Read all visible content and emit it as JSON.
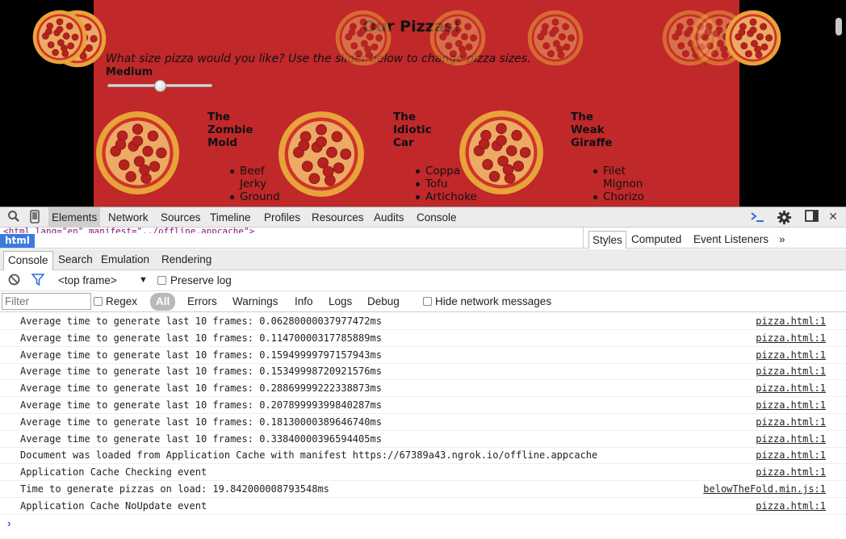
{
  "page": {
    "title": "Our Pizzas!",
    "size_prompt": "What size pizza would you like? Use the slider below to change pizza sizes.",
    "size_label": "Medium",
    "slider_fraction": 0.5,
    "menu": [
      {
        "name": [
          "The",
          "Zombie",
          "Mold"
        ],
        "ingredients": [
          [
            "Beef",
            "Jerky"
          ],
          [
            "Ground"
          ]
        ]
      },
      {
        "name": [
          "The",
          "Idiotic",
          "Car"
        ],
        "ingredients": [
          [
            "Coppa"
          ],
          [
            "Tofu"
          ],
          [
            "Artichoke"
          ]
        ]
      },
      {
        "name": [
          "The",
          "Weak",
          "Giraffe"
        ],
        "ingredients": [
          [
            "Filet",
            "Mignon"
          ],
          [
            "Chorizo"
          ]
        ]
      }
    ]
  },
  "devtools": {
    "tabs": [
      "Elements",
      "Network",
      "Sources",
      "Timeline",
      "Profiles",
      "Resources",
      "Audits",
      "Console"
    ],
    "active_tab": "Elements",
    "html_snippet": "<html lang=\"en\" manifest=\"../offline.appcache\">",
    "breadcrumb": "html",
    "side_tabs": [
      "Styles",
      "Computed",
      "Event Listeners"
    ],
    "side_more": "»",
    "drawer_tabs": [
      "Console",
      "Search",
      "Emulation",
      "Rendering"
    ],
    "frame_select": "<top frame>",
    "preserve_log": "Preserve log",
    "filter_placeholder": "Filter",
    "regex": "Regex",
    "levels": [
      "All",
      "Errors",
      "Warnings",
      "Info",
      "Logs",
      "Debug"
    ],
    "hide_network": "Hide network messages",
    "prompt": "›",
    "messages": [
      {
        "text": "Average time to generate last 10 frames: 0.06280000037977472ms",
        "source": "pizza.html:1"
      },
      {
        "text": "Average time to generate last 10 frames: 0.11470000317785889ms",
        "source": "pizza.html:1"
      },
      {
        "text": "Average time to generate last 10 frames: 0.15949999797157943ms",
        "source": "pizza.html:1"
      },
      {
        "text": "Average time to generate last 10 frames: 0.15349998720921576ms",
        "source": "pizza.html:1"
      },
      {
        "text": "Average time to generate last 10 frames: 0.28869999222338873ms",
        "source": "pizza.html:1"
      },
      {
        "text": "Average time to generate last 10 frames: 0.20789999399840287ms",
        "source": "pizza.html:1"
      },
      {
        "text": "Average time to generate last 10 frames: 0.18130000389646740ms",
        "source": "pizza.html:1"
      },
      {
        "text": "Average time to generate last 10 frames: 0.33840000396594405ms",
        "source": "pizza.html:1"
      },
      {
        "text": "Document was loaded from Application Cache with manifest https://67389a43.ngrok.io/offline.appcache",
        "source": "pizza.html:1"
      },
      {
        "text": "Application Cache Checking event",
        "source": "pizza.html:1"
      },
      {
        "text": "Time to generate pizzas on load: 19.842000008793548ms",
        "source": "belowTheFold.min.js:1"
      },
      {
        "text": "Application Cache NoUpdate event",
        "source": "pizza.html:1"
      }
    ]
  },
  "colors": {
    "page_bg": "#c0282a",
    "viewport_bg": "#000000",
    "link_blue": "#3b7bde",
    "crust": "#e8a33a",
    "sauce": "#cf3427",
    "cheese": "#f7d27c",
    "pepperoni": "#b5221f"
  },
  "icons": {
    "inspect": "magnifier-icon",
    "device": "mobile-device-icon",
    "drawer": "console-drawer-icon",
    "settings": "gear-icon",
    "dock": "dock-side-icon",
    "close": "close-icon",
    "clear": "clear-console-icon",
    "filter": "filter-funnel-icon"
  }
}
